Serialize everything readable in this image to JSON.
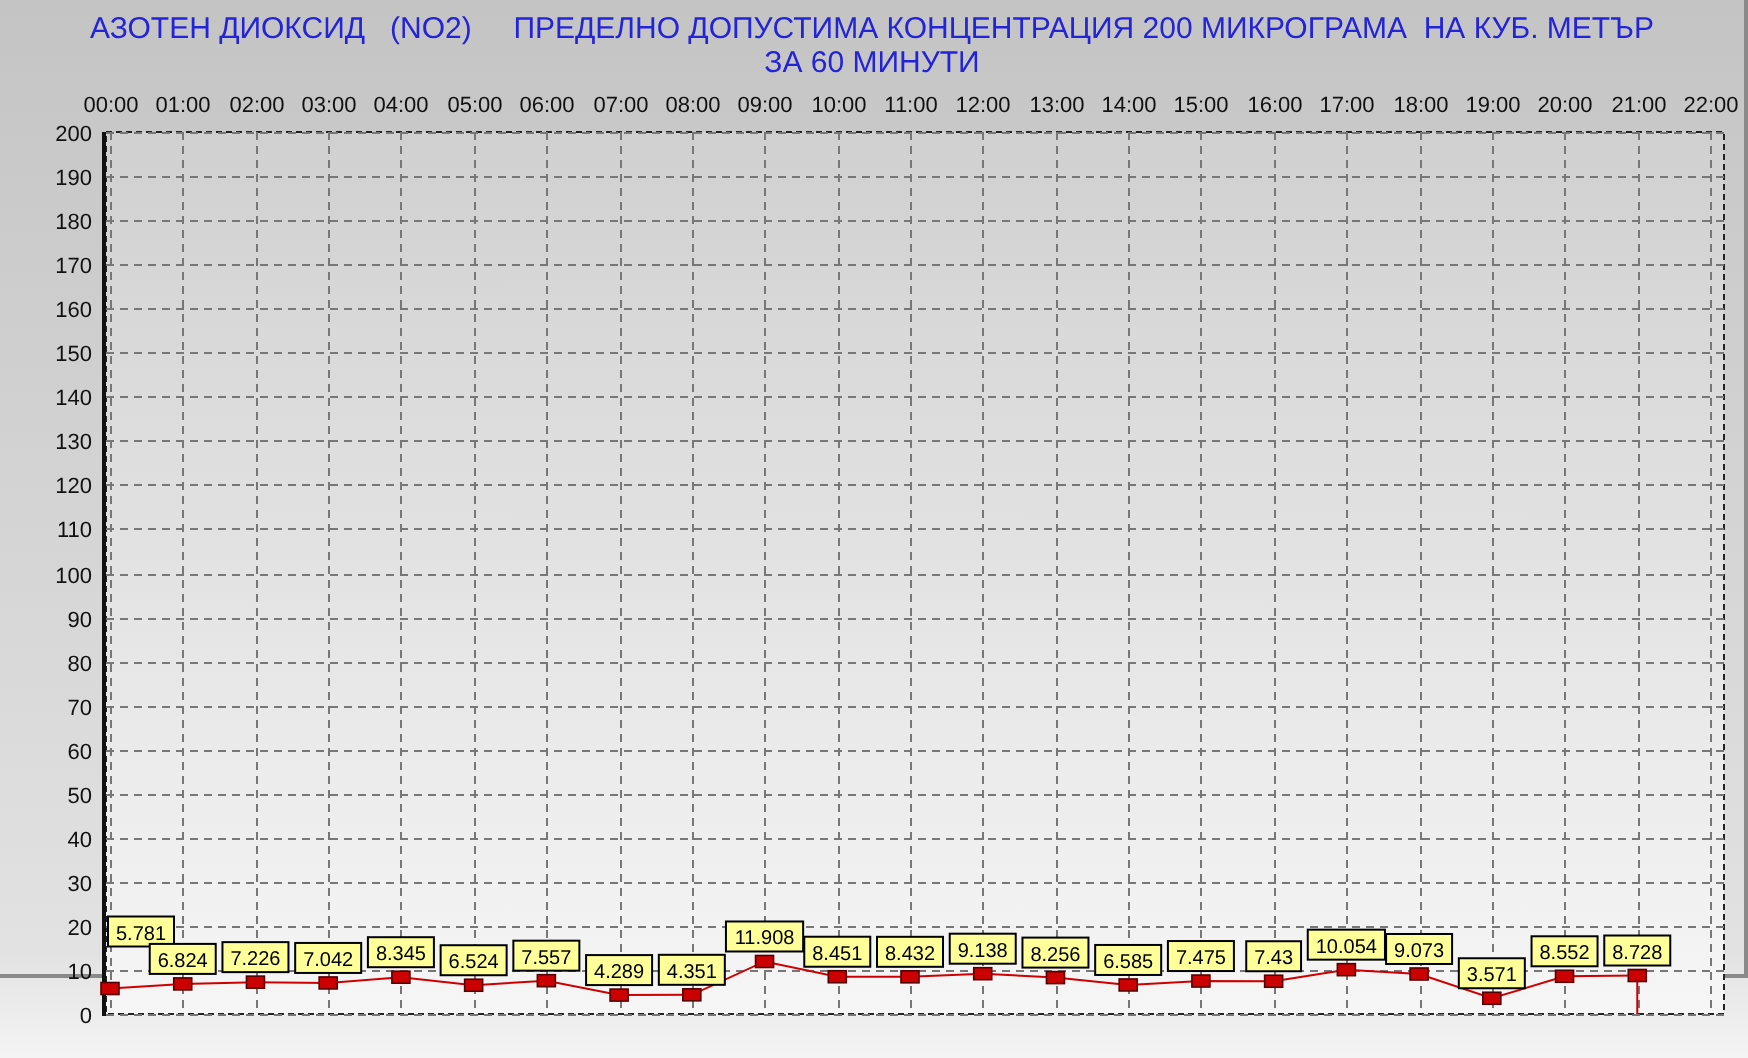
{
  "title": [
    "АЗОТЕН ДИОКСИД   (NO2)     ПРЕДЕЛНО ДОПУСТИМА КОНЦЕНТРАЦИЯ 200 МИКРОГРАМА  НА КУБ. МЕТЪР",
    "ЗА 60 МИНУТИ"
  ],
  "chart_data": {
    "type": "line",
    "x": [
      0,
      1,
      2,
      3,
      4,
      5,
      6,
      7,
      8,
      9,
      10,
      11,
      12,
      13,
      14,
      15,
      16,
      17,
      18,
      19,
      20,
      21
    ],
    "grid": true,
    "series": [
      {
        "color": "#cc0000",
        "marker": "square",
        "values": [
          5.781,
          6.824,
          7.226,
          7.042,
          8.345,
          6.524,
          7.557,
          4.289,
          4.351,
          11.908,
          8.451,
          8.432,
          9.138,
          8.256,
          6.585,
          7.475,
          7.43,
          10.054,
          9.073,
          3.571,
          8.552,
          8.728
        ]
      }
    ],
    "value_labels": [
      "5.781",
      "6.824",
      "7.226",
      "7.042",
      "8.345",
      "6.524",
      "7.557",
      "4.289",
      "4.351",
      "11.908",
      "8.451",
      "8.432",
      "9.138",
      "8.256",
      "6.585",
      "7.475",
      "7.43",
      "10.054",
      "9.073",
      "3.571",
      "8.552",
      "8.728"
    ],
    "xlim": [
      0,
      22
    ],
    "ylim": [
      0,
      200
    ],
    "xticks": [
      {
        "value": 0,
        "label": "00:00"
      },
      {
        "value": 1,
        "label": "01:00"
      },
      {
        "value": 2,
        "label": "02:00"
      },
      {
        "value": 3,
        "label": "03:00"
      },
      {
        "value": 4,
        "label": "04:00"
      },
      {
        "value": 5,
        "label": "05:00"
      },
      {
        "value": 6,
        "label": "06:00"
      },
      {
        "value": 7,
        "label": "07:00"
      },
      {
        "value": 8,
        "label": "08:00"
      },
      {
        "value": 9,
        "label": "09:00"
      },
      {
        "value": 10,
        "label": "10:00"
      },
      {
        "value": 11,
        "label": "11:00"
      },
      {
        "value": 12,
        "label": "12:00"
      },
      {
        "value": 13,
        "label": "13:00"
      },
      {
        "value": 14,
        "label": "14:00"
      },
      {
        "value": 15,
        "label": "15:00"
      },
      {
        "value": 16,
        "label": "16:00"
      },
      {
        "value": 17,
        "label": "17:00"
      },
      {
        "value": 18,
        "label": "18:00"
      },
      {
        "value": 19,
        "label": "19:00"
      },
      {
        "value": 20,
        "label": "20:00"
      },
      {
        "value": 21,
        "label": "21:00"
      },
      {
        "value": 22,
        "label": "22:00"
      }
    ],
    "yticks": [
      0,
      10,
      20,
      30,
      40,
      50,
      60,
      70,
      80,
      90,
      100,
      110,
      120,
      130,
      140,
      150,
      160,
      170,
      180,
      190,
      200
    ]
  }
}
